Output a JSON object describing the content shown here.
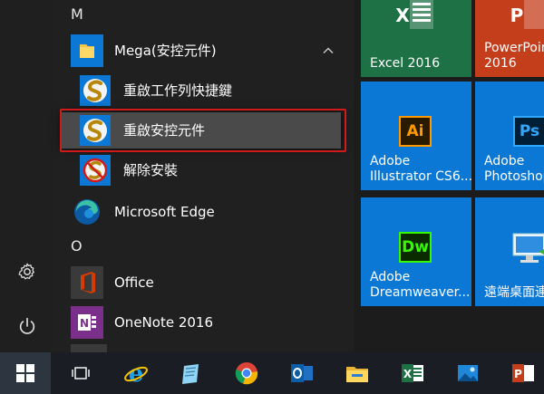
{
  "app_list": {
    "letter_m": "M",
    "mega_group": {
      "label": "Mega(安控元件)"
    },
    "mega_items": [
      {
        "label": "重啟工作列快捷鍵"
      },
      {
        "label": "重啟安控元件"
      },
      {
        "label": "解除安裝"
      }
    ],
    "edge": {
      "label": "Microsoft Edge"
    },
    "letter_o": "O",
    "office": {
      "label": "Office"
    },
    "onenote": {
      "label": "OneNote 2016"
    }
  },
  "tiles": {
    "excel": {
      "label": "Excel 2016",
      "color": "#1e7145"
    },
    "powerpoint": {
      "label": "PowerPoint\n2016",
      "color": "#c43e1c"
    },
    "illustrator": {
      "label": "Adobe\nIllustrator CS6...",
      "color": "#0a78d4",
      "icon_text": "Ai"
    },
    "photoshop": {
      "label": "Adobe\nPhotoshop...",
      "color": "#0a78d4",
      "icon_text": "Ps"
    },
    "dreamweaver": {
      "label": "Adobe\nDreamweaver...",
      "color": "#0a78d4",
      "icon_text": "Dw"
    },
    "remote_desktop": {
      "label": "遠端桌面連線",
      "color": "#0a78d4"
    }
  },
  "highlight_color": "#d11a1a",
  "accent_blue": "#0a78d4"
}
